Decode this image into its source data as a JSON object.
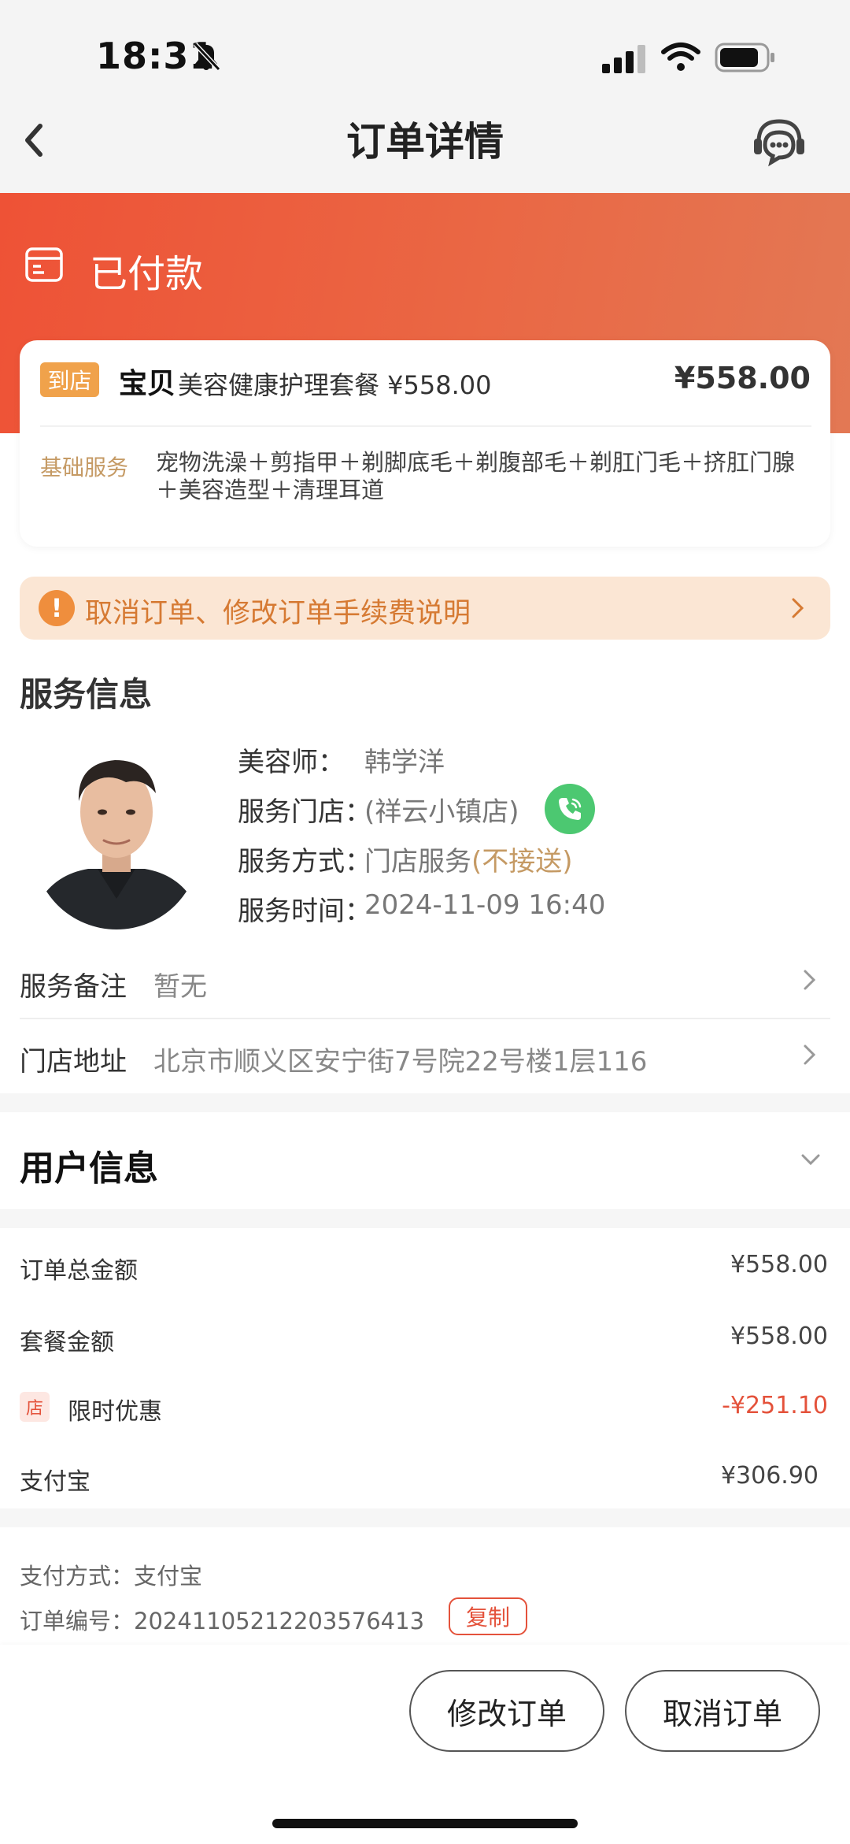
{
  "status_bar": {
    "time": "18:31"
  },
  "nav": {
    "title": "订单详情"
  },
  "order_status": "已付款",
  "product": {
    "store_tag": "到店",
    "brand": "宝贝",
    "name": "美容健康护理套餐 ¥558.00",
    "price": "¥558.00",
    "base_label": "基础服务",
    "base_items": "宠物洗澡＋剪指甲＋剃脚底毛＋剃腹部毛＋剃肛门毛＋挤肛门腺＋美容造型＋清理耳道"
  },
  "notice": {
    "icon": "!",
    "text": "取消订单、修改订单手续费说明"
  },
  "service_info": {
    "title": "服务信息",
    "beautician_label": "美容师：",
    "beautician": "韩学洋",
    "store_label": "服务门店：",
    "store": "(祥云小镇店)",
    "mode_label": "服务方式：",
    "mode": "门店服务",
    "mode_note": "(不接送)",
    "time_label": "服务时间：",
    "time": "2024-11-09 16:40",
    "remark_label": "服务备注",
    "remark": "暂无",
    "address_label": "门店地址",
    "address": "北京市顺义区安宁街7号院22号楼1层116"
  },
  "user_info": {
    "title": "用户信息"
  },
  "pricing": {
    "total_label": "订单总金额",
    "total": "¥558.00",
    "package_label": "套餐金额",
    "package": "¥558.00",
    "discount_tag": "店",
    "discount_label": "限时优惠",
    "discount": "-¥251.10",
    "alipay_label": "支付宝",
    "alipay": "¥306.90"
  },
  "payment": {
    "method_label": "支付方式：",
    "method": "支付宝",
    "order_no_label": "订单编号：",
    "order_no": "2024110521220357641­3",
    "copy_label": "复制"
  },
  "actions": {
    "modify": "修改订单",
    "cancel": "取消订单"
  },
  "colors": {
    "brand_orange": "#ee5236",
    "accent_gold": "#c59a64",
    "discount_red": "#e4523b",
    "call_green": "#4cc871"
  }
}
